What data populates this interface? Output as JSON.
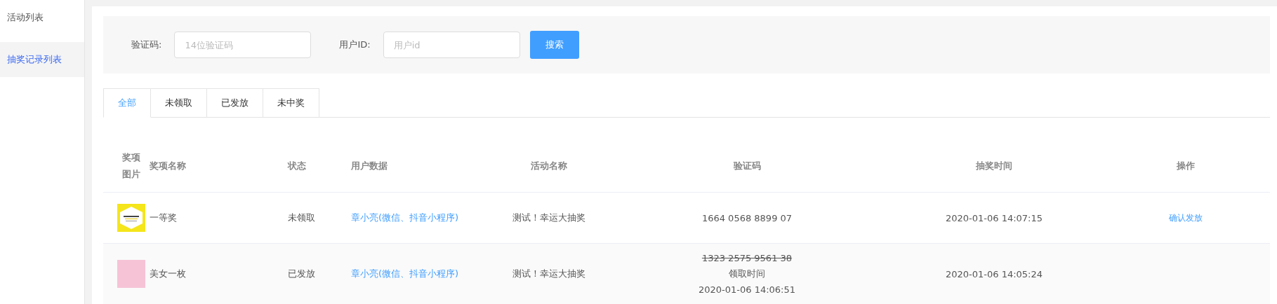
{
  "sidebar": {
    "items": [
      {
        "label": "活动列表",
        "selected": false
      },
      {
        "label": "抽奖记录列表",
        "selected": true
      }
    ]
  },
  "filters": [
    {
      "label": "验证码:",
      "placeholder": "14位验证码"
    },
    {
      "label": "用户ID:",
      "placeholder": "用户id"
    }
  ],
  "search_button": "搜索",
  "tabs": [
    {
      "label": "全部",
      "selected": true
    },
    {
      "label": "未领取",
      "selected": false
    },
    {
      "label": "已发放",
      "selected": false
    },
    {
      "label": "未中奖",
      "selected": false
    }
  ],
  "table": {
    "columns": [
      "奖项图片",
      "奖项名称",
      "状态",
      "用户数据",
      "活动名称",
      "验证码",
      "抽奖时间",
      "操作"
    ],
    "rows": [
      {
        "kind": "poster",
        "prize": "一等奖",
        "status": "未领取",
        "user": "章小亮(微信、抖音小程序)",
        "activity": "测试！幸运大抽奖",
        "code": "1664 0568 8899 07",
        "code_struck": false,
        "draw_time": "2020-01-06 14:07:15",
        "action": "确认发放"
      },
      {
        "kind": "photo",
        "prize": "美女一枚",
        "status": "已发放",
        "user": "章小亮(微信、抖音小程序)",
        "activity": "测试！幸运大抽奖",
        "code": "1323 2575 9561 38",
        "code_struck": true,
        "claim_label": "领取时间",
        "claim_time": "2020-01-06 14:06:51",
        "draw_time": "2020-01-06 14:05:24"
      }
    ]
  }
}
